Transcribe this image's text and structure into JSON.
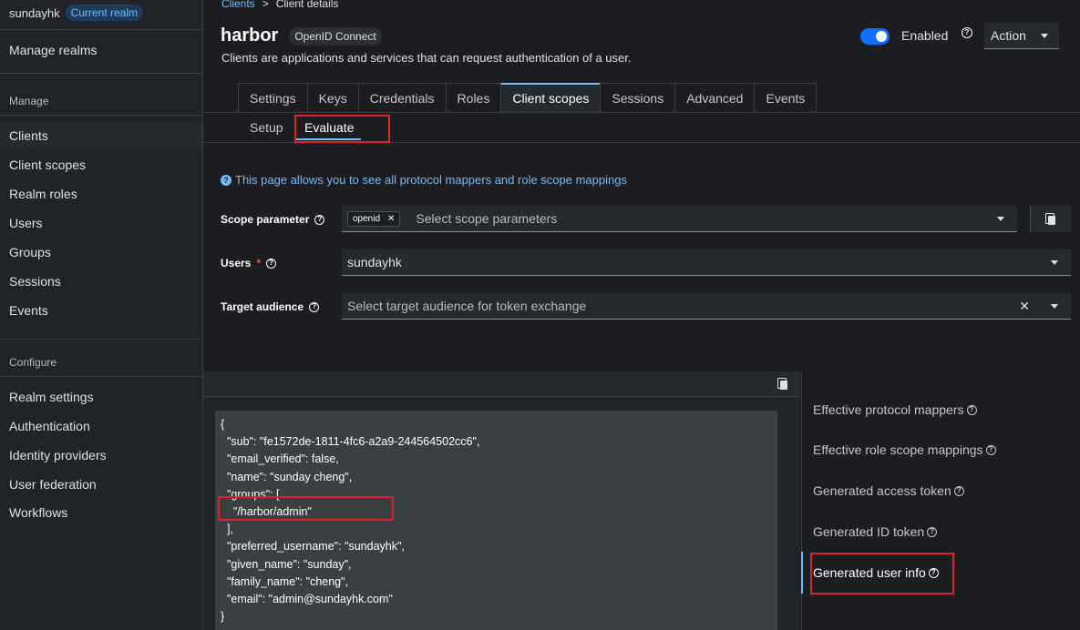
{
  "sidebar": {
    "realm_name": "sundayhk",
    "realm_badge": "Current realm",
    "manage_realms": "Manage realms",
    "manage_section": "Manage",
    "manage_items": [
      "Clients",
      "Client scopes",
      "Realm roles",
      "Users",
      "Groups",
      "Sessions",
      "Events"
    ],
    "configure_section": "Configure",
    "configure_items": [
      "Realm settings",
      "Authentication",
      "Identity providers",
      "User federation",
      "Workflows"
    ]
  },
  "breadcrumb": {
    "parent": "Clients",
    "separator": ">",
    "current": "Client details"
  },
  "header": {
    "title": "harbor",
    "badge": "OpenID Connect",
    "subtitle": "Clients are applications and services that can request authentication of a user.",
    "enabled_label": "Enabled",
    "enabled": true,
    "action_label": "Action"
  },
  "tabs": [
    "Settings",
    "Keys",
    "Credentials",
    "Roles",
    "Client scopes",
    "Sessions",
    "Advanced",
    "Events"
  ],
  "active_tab": "Client scopes",
  "subtabs": [
    "Setup",
    "Evaluate"
  ],
  "active_subtab": "Evaluate",
  "info_text": "This page allows you to see all protocol mappers and role scope mappings",
  "form": {
    "scope_label": "Scope parameter",
    "scope_chip": "openid",
    "scope_placeholder": "Select scope parameters",
    "users_label": "Users",
    "users_required_mark": "*",
    "users_value": "sundayhk",
    "audience_label": "Target audience",
    "audience_placeholder": "Select target audience for token exchange"
  },
  "code_lines": [
    "{",
    "  \"sub\": \"fe1572de-1811-4fc6-a2a9-244564502cc6\",",
    "  \"email_verified\": false,",
    "  \"name\": \"sunday cheng\",",
    "  \"groups\": [",
    "    \"/harbor/admin\"",
    "  ],",
    "  \"preferred_username\": \"sundayhk\",",
    "  \"given_name\": \"sunday\",",
    "  \"family_name\": \"cheng\",",
    "  \"email\": \"admin@sundayhk.com\"",
    "}"
  ],
  "evaluate_menu": [
    "Effective protocol mappers",
    "Effective role scope mappings",
    "Generated access token",
    "Generated ID token",
    "Generated user info"
  ],
  "active_evaluate_item": "Generated user info",
  "colors": {
    "accent": "#73bcf7",
    "toggle": "#0d6efd",
    "highlight": "#e0202a"
  }
}
